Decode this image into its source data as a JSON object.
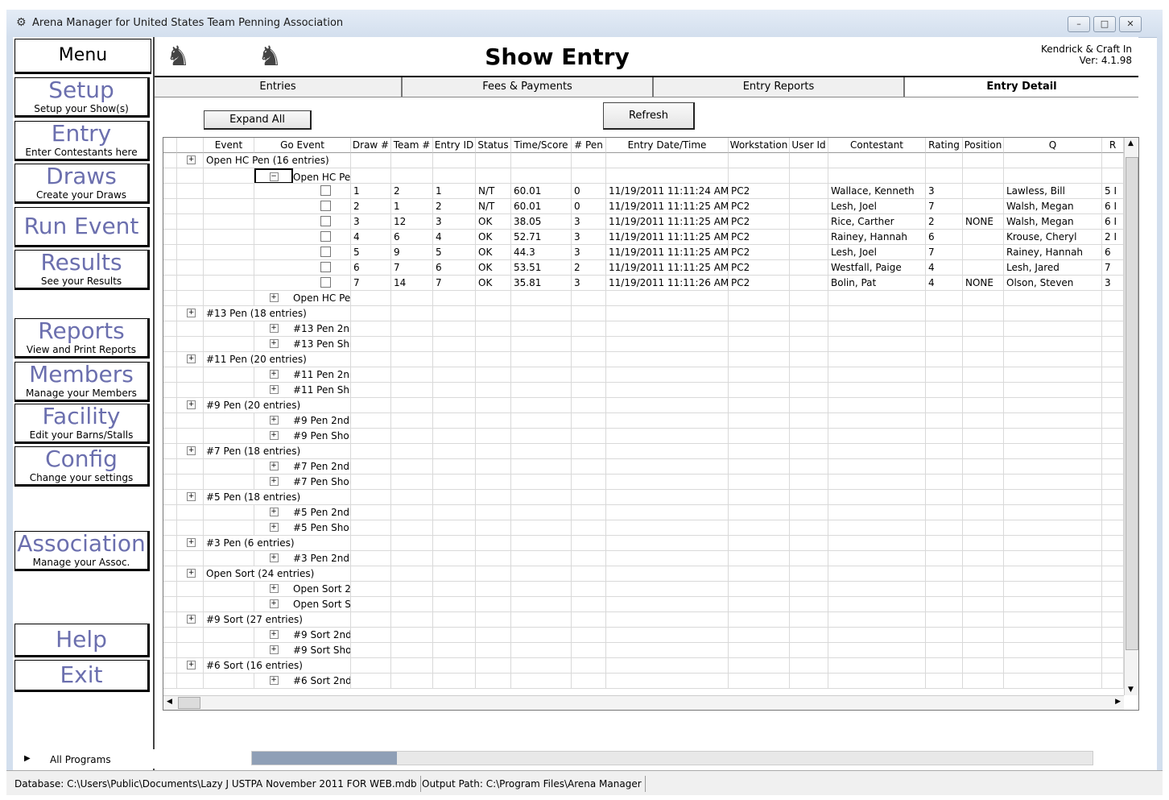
{
  "window": {
    "title": "Arena Manager for United States Team Penning Association",
    "min": "–",
    "max": "□",
    "close": "✕"
  },
  "menu": {
    "heading": "Menu",
    "items": [
      {
        "title": "Setup",
        "sub": "Setup your Show(s)"
      },
      {
        "title": "Entry",
        "sub": "Enter Contestants here"
      },
      {
        "title": "Draws",
        "sub": "Create your Draws"
      },
      {
        "title": "Run Event",
        "sub": ""
      },
      {
        "title": "Results",
        "sub": "See your Results"
      },
      {
        "title": "Reports",
        "sub": "View and Print Reports"
      },
      {
        "title": "Members",
        "sub": "Manage your Members"
      },
      {
        "title": "Facility",
        "sub": "Edit your Barns/Stalls"
      },
      {
        "title": "Config",
        "sub": "Change your settings"
      },
      {
        "title": "Association",
        "sub": "Manage your Assoc."
      },
      {
        "title": "Help",
        "sub": ""
      },
      {
        "title": "Exit",
        "sub": ""
      }
    ]
  },
  "header": {
    "title": "Show Entry",
    "company": "Kendrick & Craft In",
    "version": "Ver: 4.1.98"
  },
  "tabs": [
    "Entries",
    "Fees & Payments",
    "Entry Reports",
    "Entry Detail"
  ],
  "toolbar": {
    "expand_all": "Expand All",
    "refresh": "Refresh"
  },
  "grid": {
    "columns": [
      "Event",
      "Go Event",
      "Draw #",
      "Team #",
      "Entry ID",
      "Status",
      "Time/Score",
      "# Pen",
      "Entry Date/Time",
      "Workstation",
      "User Id",
      "Contestant",
      "Rating",
      "Position",
      "Q",
      "R"
    ],
    "rows": [
      {
        "kind": "event",
        "pm": "+",
        "label": "Open HC Pen (16 entries)"
      },
      {
        "kind": "go",
        "pm": "−",
        "label": "Open HC Pe",
        "focused": true
      },
      {
        "kind": "entry",
        "draw": "1",
        "team": "2",
        "entry_id": "1",
        "status": "N/T",
        "time": "60.01",
        "pen": "0",
        "date": "11/19/2011 11:11:24 AM",
        "ws": "PC2",
        "user": "",
        "contestant": "Wallace, Kenneth",
        "rating": "3",
        "position": "",
        "q": "Lawless, Bill",
        "r": "5 I"
      },
      {
        "kind": "entry",
        "draw": "2",
        "team": "1",
        "entry_id": "2",
        "status": "N/T",
        "time": "60.01",
        "pen": "0",
        "date": "11/19/2011 11:11:25 AM",
        "ws": "PC2",
        "user": "",
        "contestant": "Lesh, Joel",
        "rating": "7",
        "position": "",
        "q": "Walsh, Megan",
        "r": "6 I"
      },
      {
        "kind": "entry",
        "draw": "3",
        "team": "12",
        "entry_id": "3",
        "status": "OK",
        "time": "38.05",
        "pen": "3",
        "date": "11/19/2011 11:11:25 AM",
        "ws": "PC2",
        "user": "",
        "contestant": "Rice, Carther",
        "rating": "2",
        "position": "NONE",
        "q": "Walsh, Megan",
        "r": "6 I"
      },
      {
        "kind": "entry",
        "draw": "4",
        "team": "6",
        "entry_id": "4",
        "status": "OK",
        "time": "52.71",
        "pen": "3",
        "date": "11/19/2011 11:11:25 AM",
        "ws": "PC2",
        "user": "",
        "contestant": "Rainey, Hannah",
        "rating": "6",
        "position": "",
        "q": "Krouse, Cheryl",
        "r": "2 I"
      },
      {
        "kind": "entry",
        "draw": "5",
        "team": "9",
        "entry_id": "5",
        "status": "OK",
        "time": "44.3",
        "pen": "3",
        "date": "11/19/2011 11:11:25 AM",
        "ws": "PC2",
        "user": "",
        "contestant": "Lesh, Joel",
        "rating": "7",
        "position": "",
        "q": "Rainey, Hannah",
        "r": "6"
      },
      {
        "kind": "entry",
        "draw": "6",
        "team": "7",
        "entry_id": "6",
        "status": "OK",
        "time": "53.51",
        "pen": "2",
        "date": "11/19/2011 11:11:25 AM",
        "ws": "PC2",
        "user": "",
        "contestant": "Westfall, Paige",
        "rating": "4",
        "position": "",
        "q": "Lesh, Jared",
        "r": "7"
      },
      {
        "kind": "entry",
        "draw": "7",
        "team": "14",
        "entry_id": "7",
        "status": "OK",
        "time": "35.81",
        "pen": "3",
        "date": "11/19/2011 11:11:26 AM",
        "ws": "PC2",
        "user": "",
        "contestant": "Bolin, Pat",
        "rating": "4",
        "position": "NONE",
        "q": "Olson, Steven",
        "r": "3"
      },
      {
        "kind": "go",
        "pm": "+",
        "label": "Open HC Pe"
      },
      {
        "kind": "event",
        "pm": "+",
        "label": "#13 Pen (18 entries)"
      },
      {
        "kind": "go",
        "pm": "+",
        "label": "#13 Pen 2n"
      },
      {
        "kind": "go",
        "pm": "+",
        "label": "#13 Pen Sh"
      },
      {
        "kind": "event",
        "pm": "+",
        "label": "#11 Pen (20 entries)"
      },
      {
        "kind": "go",
        "pm": "+",
        "label": "#11 Pen 2n"
      },
      {
        "kind": "go",
        "pm": "+",
        "label": "#11 Pen Sh"
      },
      {
        "kind": "event",
        "pm": "+",
        "label": "#9 Pen (20 entries)"
      },
      {
        "kind": "go",
        "pm": "+",
        "label": "#9 Pen 2nd"
      },
      {
        "kind": "go",
        "pm": "+",
        "label": "#9 Pen Sho"
      },
      {
        "kind": "event",
        "pm": "+",
        "label": "#7 Pen (18 entries)"
      },
      {
        "kind": "go",
        "pm": "+",
        "label": "#7 Pen 2nd"
      },
      {
        "kind": "go",
        "pm": "+",
        "label": "#7 Pen Sho"
      },
      {
        "kind": "event",
        "pm": "+",
        "label": "#5 Pen (18 entries)"
      },
      {
        "kind": "go",
        "pm": "+",
        "label": "#5 Pen 2nd"
      },
      {
        "kind": "go",
        "pm": "+",
        "label": "#5 Pen Sho"
      },
      {
        "kind": "event",
        "pm": "+",
        "label": "#3 Pen (6 entries)"
      },
      {
        "kind": "go",
        "pm": "+",
        "label": "#3 Pen 2nd"
      },
      {
        "kind": "event",
        "pm": "+",
        "label": "Open Sort (24 entries)"
      },
      {
        "kind": "go",
        "pm": "+",
        "label": "Open Sort 2"
      },
      {
        "kind": "go",
        "pm": "+",
        "label": "Open Sort S"
      },
      {
        "kind": "event",
        "pm": "+",
        "label": "#9 Sort (27 entries)"
      },
      {
        "kind": "go",
        "pm": "+",
        "label": "#9 Sort 2nd"
      },
      {
        "kind": "go",
        "pm": "+",
        "label": "#9 Sort Sho"
      },
      {
        "kind": "event",
        "pm": "+",
        "label": "#6 Sort (16 entries)"
      },
      {
        "kind": "go",
        "pm": "+",
        "label": "#6 Sort 2nd"
      }
    ]
  },
  "start_menu": {
    "all_programs": "All Programs"
  },
  "status": {
    "database": "Database: C:\\Users\\Public\\Documents\\Lazy J USTPA November 2011 FOR WEB.mdb",
    "output": "Output Path: C:\\Program Files\\Arena Manager"
  }
}
